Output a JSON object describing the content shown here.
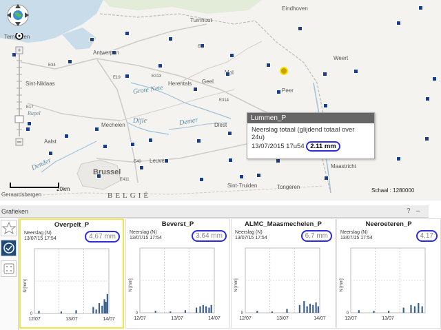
{
  "map": {
    "places": [
      {
        "name": "Eindhoven"
      },
      {
        "name": "Turnhout"
      },
      {
        "name": "Antwerpen"
      },
      {
        "name": "Weert"
      },
      {
        "name": "Terneuzen"
      },
      {
        "name": "Sint-Niklaas"
      },
      {
        "name": "Herentals"
      },
      {
        "name": "Geel"
      },
      {
        "name": "Mol"
      },
      {
        "name": "Peer"
      },
      {
        "name": "Mechelen"
      },
      {
        "name": "Diest"
      },
      {
        "name": "Aalst"
      },
      {
        "name": "Leuven"
      },
      {
        "name": "Maastricht"
      },
      {
        "name": "Sint-Truiden"
      },
      {
        "name": "Tongeren"
      },
      {
        "name": "Geraardsbergen"
      },
      {
        "name": "E34"
      },
      {
        "name": "E313"
      },
      {
        "name": "E314"
      },
      {
        "name": "E17"
      },
      {
        "name": "E40"
      },
      {
        "name": "E19"
      },
      {
        "name": "E411"
      },
      {
        "name": "E34"
      }
    ],
    "rivers": [
      "Grote Nete",
      "Dijle",
      "Demer",
      "Dender",
      "Rupel"
    ],
    "city_bold": "Brussel",
    "country_label": "BELGIË",
    "scale_label": "20km",
    "scale_text": "Schaal : 1280000",
    "popup": {
      "title": "Lummen_P",
      "line1": "Neerslag totaal (glijdend totaal over",
      "line2": "24u)",
      "time": "13/07/2015 17u54",
      "value": "2.11 mm"
    }
  },
  "panel": {
    "title": "Grafieken",
    "help": "?",
    "close": "–",
    "cards": [
      {
        "name": "Overpelt_P",
        "label": "Neerslag (N)",
        "time": "13/07/15 17:54",
        "value": "4,67 mm",
        "ylabel": "N [mm]",
        "xticks": [
          "12/07",
          "13/07",
          "14/07"
        ]
      },
      {
        "name": "Beverst_P",
        "label": "Neerslag (N)",
        "time": "13/07/15 17:54",
        "value": "3,64 mm",
        "ylabel": "N [mm]",
        "xticks": [
          "12/07",
          "13/07",
          "14/07"
        ]
      },
      {
        "name": "ALMC_Maasmechelen_P",
        "label": "Neerslag (N)",
        "time": "13/07/15 17:54",
        "value": "6,7 mm",
        "ylabel": "N [mm]",
        "xticks": [
          "12/07",
          "13/07",
          "14/07"
        ]
      },
      {
        "name": "Neeroeteren_P",
        "label": "Neerslag (N)",
        "time": "13/07/15 17:54",
        "value": "4,17",
        "ylabel": "N [mm]",
        "xticks": [
          "12/07",
          "13/07"
        ]
      }
    ]
  },
  "colors": {
    "station": "#1a3c8f",
    "highlight": "#2b2bdb",
    "selected_ring": "#f5e300",
    "bars": "#3a5f8f"
  }
}
